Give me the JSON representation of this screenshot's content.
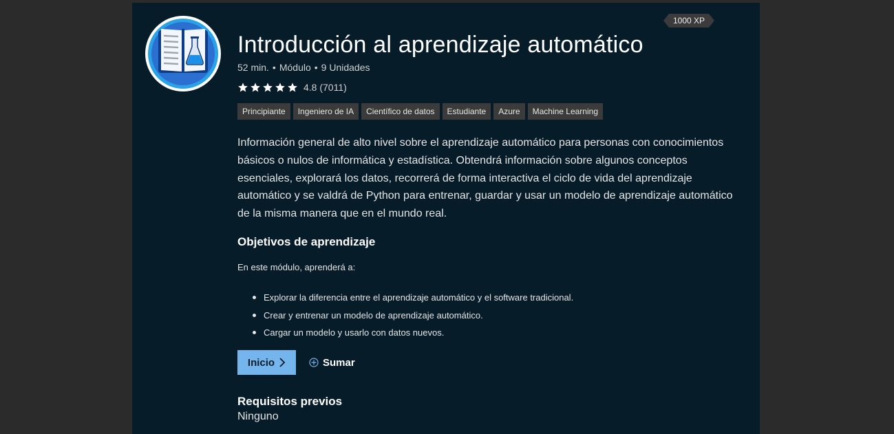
{
  "module": {
    "xp": "1000 XP",
    "title": "Introducción al aprendizaje automático",
    "duration": "52 min.",
    "type": "Módulo",
    "units": "9 Unidades",
    "rating_score": "4.8",
    "rating_count": "(7011)",
    "tags": [
      "Principiante",
      "Ingeniero de IA",
      "Científico de datos",
      "Estudiante",
      "Azure",
      "Machine Learning"
    ],
    "description": "Información general de alto nivel sobre el aprendizaje automático para personas con conocimientos básicos o nulos de informática y estadística. Obtendrá información sobre algunos conceptos esenciales, explorará los datos, recorrerá de forma interactiva el ciclo de vida del aprendizaje automático y se valdrá de Python para entrenar, guardar y usar un modelo de aprendizaje automático de la misma manera que en el mundo real."
  },
  "objectives": {
    "heading": "Objetivos de aprendizaje",
    "intro": "En este módulo, aprenderá a:",
    "items": [
      "Explorar la diferencia entre el aprendizaje automático y el software tradicional.",
      "Crear y entrenar un modelo de aprendizaje automático.",
      "Cargar un modelo y usarlo con datos nuevos."
    ]
  },
  "actions": {
    "start_label": "Inicio",
    "add_label": "Sumar"
  },
  "prerequisites": {
    "heading": "Requisitos previos",
    "value": "Ninguno"
  },
  "icons": {
    "logo": "book-flask-icon",
    "star": "star-icon",
    "start": "chevron-right-icon",
    "add": "circle-plus-icon"
  },
  "colors": {
    "panel_bg": "#061c29",
    "accent_button": "#74b5ee",
    "tag_bg": "#3b3b3b"
  }
}
